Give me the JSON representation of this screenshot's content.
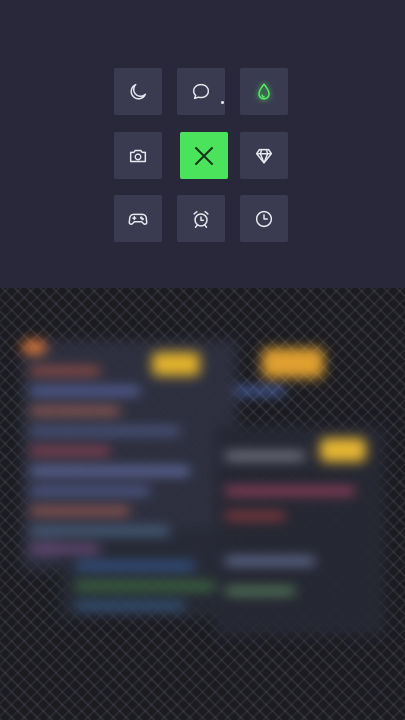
{
  "launcher": {
    "tiles": [
      {
        "icon": "moon-icon",
        "label": "night-mode"
      },
      {
        "icon": "chat-bubble-icon",
        "label": "messages"
      },
      {
        "icon": "droplet-icon",
        "label": "water",
        "state": "highlighted"
      },
      {
        "icon": "camera-icon",
        "label": "camera"
      },
      {
        "icon": "close-icon",
        "label": "close",
        "state": "active"
      },
      {
        "icon": "diamond-icon",
        "label": "premium"
      },
      {
        "icon": "gamepad-icon",
        "label": "games"
      },
      {
        "icon": "alarm-clock-icon",
        "label": "alarm"
      },
      {
        "icon": "clock-icon",
        "label": "clock"
      }
    ],
    "colors": {
      "tile": "#3a3b50",
      "active": "#4be35c",
      "glow": "#52ef63",
      "background": "#29283a"
    }
  },
  "wallpaper": {
    "description_tokens": [
      "blurred-code-editor"
    ]
  }
}
